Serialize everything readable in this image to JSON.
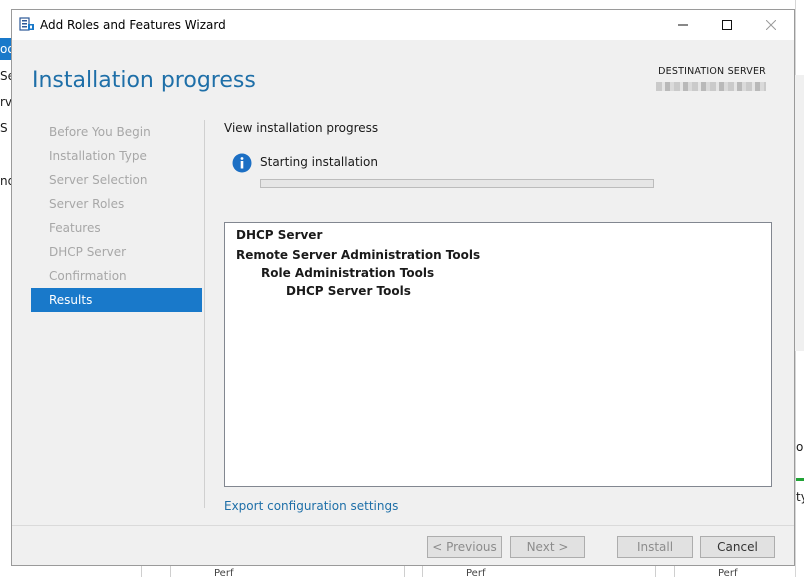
{
  "window": {
    "title": "Add Roles and Features Wizard",
    "min_glyph": "—",
    "max_glyph": "☐",
    "close_glyph": "✕"
  },
  "header": {
    "page_title": "Installation progress",
    "destination_label": "DESTINATION SERVER"
  },
  "nav": {
    "items": [
      {
        "label": "Before You Begin",
        "state": "disabled"
      },
      {
        "label": "Installation Type",
        "state": "disabled"
      },
      {
        "label": "Server Selection",
        "state": "disabled"
      },
      {
        "label": "Server Roles",
        "state": "disabled"
      },
      {
        "label": "Features",
        "state": "disabled"
      },
      {
        "label": "DHCP Server",
        "state": "disabled"
      },
      {
        "label": "Confirmation",
        "state": "disabled"
      },
      {
        "label": "Results",
        "state": "active"
      }
    ]
  },
  "content": {
    "view_label": "View installation progress",
    "status_text": "Starting installation",
    "progress": 0,
    "results": [
      {
        "label": "DHCP Server",
        "level": 0
      },
      {
        "label": "Remote Server Administration Tools",
        "level": 0
      },
      {
        "label": "Role Administration Tools",
        "level": 1
      },
      {
        "label": "DHCP Server Tools",
        "level": 2
      }
    ],
    "export_link": "Export configuration settings"
  },
  "footer": {
    "previous": "< Previous",
    "next": "Next >",
    "install": "Install",
    "cancel": "Cancel"
  },
  "background": {
    "left_fragments": [
      "oo",
      "Se",
      "rv",
      "S",
      "nd"
    ],
    "right_fragments": [
      "o",
      "ty"
    ],
    "bottom_fragments": [
      "Perf",
      "Perf",
      "Perf"
    ]
  },
  "colors": {
    "accent": "#1979ca",
    "title_blue": "#1e6fa8",
    "progress_green": "#06b025",
    "nav_disabled": "#a7a7a7"
  },
  "icons": {
    "title_icon": "server-manager-icon",
    "status_icon": "info-icon"
  }
}
